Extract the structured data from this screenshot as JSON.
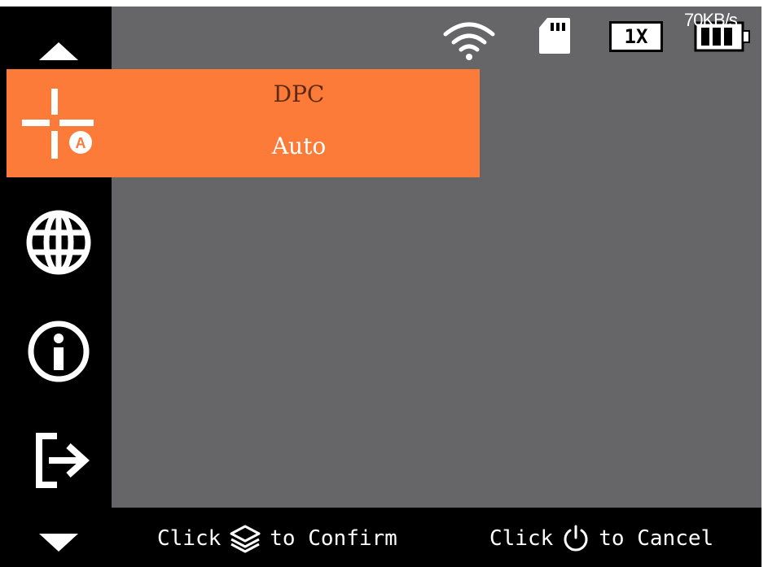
{
  "status": {
    "wifi_icon": "wifi-icon",
    "sd_card_icon": "sd-card-icon",
    "zoom_level": "1X",
    "transfer_rate": "70KB/s",
    "battery_icon": "battery-icon"
  },
  "menu": {
    "up_icon": "arrow-up-icon",
    "down_icon": "arrow-down-icon",
    "selected": {
      "icon": "dpc-crosshair-auto-icon",
      "title": "DPC",
      "value": "Auto"
    },
    "items": [
      {
        "icon": "globe-icon"
      },
      {
        "icon": "info-icon"
      },
      {
        "icon": "exit-icon"
      }
    ]
  },
  "footer": {
    "confirm_prefix": "Click",
    "confirm_suffix": "to Confirm",
    "confirm_icon": "layers-icon",
    "cancel_prefix": "Click",
    "cancel_suffix": "to Cancel",
    "cancel_icon": "power-icon"
  },
  "colors": {
    "accent": "#fd7b38",
    "viewport": "#666567",
    "title_text": "#5e2a12"
  }
}
